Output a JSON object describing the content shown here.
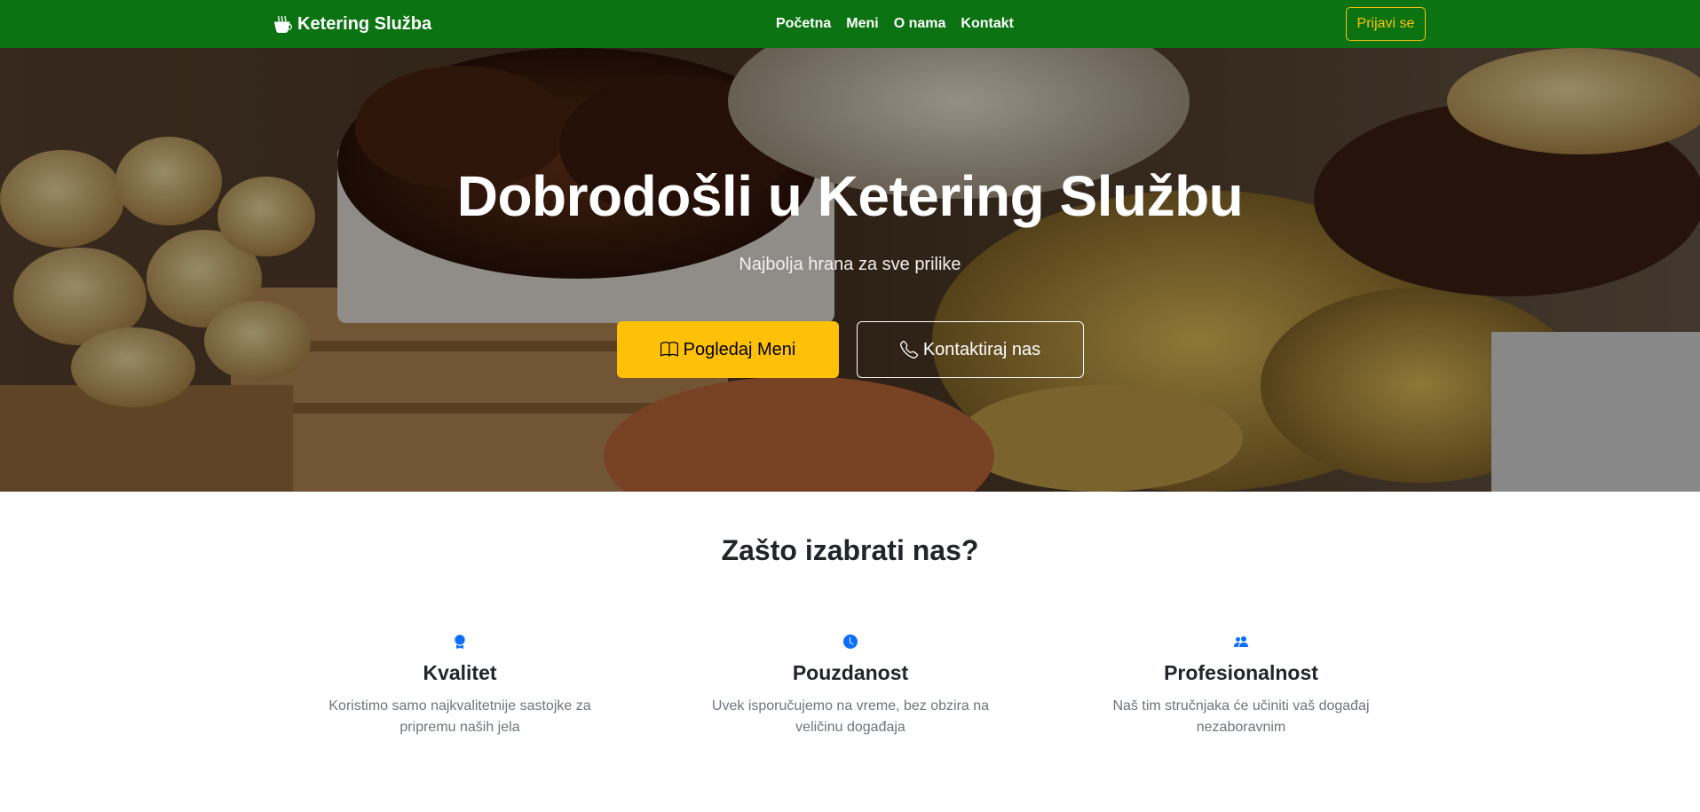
{
  "navbar": {
    "brand": "Ketering Služba",
    "brand_icon": "cup-hot-icon",
    "links": [
      "Početna",
      "Meni",
      "O nama",
      "Kontakt"
    ],
    "login_label": "Prijavi se",
    "bg_color": "#0b7312",
    "accent_color": "#ffc107"
  },
  "hero": {
    "title": "Dobrodošli u Ketering Službu",
    "subtitle": "Najbolja hrana za sve prilike",
    "primary_button": {
      "label": "Pogledaj Meni",
      "icon": "book-icon"
    },
    "secondary_button": {
      "label": "Kontaktiraj nas",
      "icon": "telephone-icon"
    }
  },
  "features": {
    "title": "Zašto izabrati nas?",
    "icon_color": "#0d6efd",
    "items": [
      {
        "icon": "award-icon",
        "title": "Kvalitet",
        "text": "Koristimo samo najkvalitetnije sastojke za pripremu naših jela"
      },
      {
        "icon": "clock-icon",
        "title": "Pouzdanost",
        "text": "Uvek isporučujemo na vreme, bez obzira na veličinu događaja"
      },
      {
        "icon": "people-icon",
        "title": "Profesionalnost",
        "text": "Naš tim stručnjaka će učiniti vaš događaj nezaboravnim"
      }
    ]
  }
}
